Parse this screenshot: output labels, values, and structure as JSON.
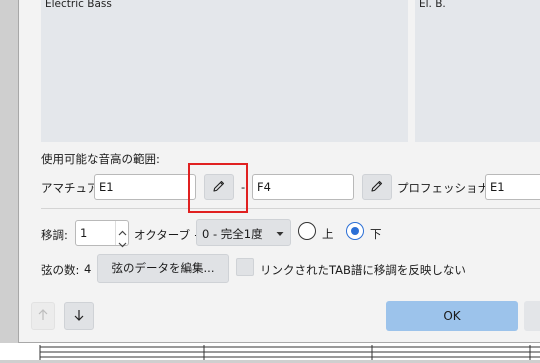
{
  "previews": {
    "left_name": "Electric Bass",
    "right_name": "El. B."
  },
  "range": {
    "heading": "使用可能な音高の範囲:",
    "amateur_label": "アマチュア:",
    "amateur_low": "E1",
    "dash": "-",
    "amateur_high": "F4",
    "professional_label": "プロフェッショナル:",
    "professional_low": "E1"
  },
  "transpose": {
    "label": "移調:",
    "octave_value": "1",
    "octave_label": "オクターブ +",
    "interval_value": "0 - 完全1度",
    "up_label": "上",
    "down_label": "下",
    "selected": "down"
  },
  "strings": {
    "count_label": "弦の数:",
    "count_value": "4",
    "edit_button": "弦のデータを編集...",
    "linked_tab_label": "リンクされたTAB譜に移調を反映しない",
    "linked_tab_checked": false
  },
  "footer": {
    "ok_label": "OK"
  },
  "icons": {
    "pencil": "pencil-icon",
    "arrow_up": "arrow-up-icon",
    "arrow_down": "arrow-down-icon",
    "spin_up": "chevron-up-icon",
    "spin_down": "chevron-down-icon",
    "dropdown": "caret-down-icon"
  },
  "colors": {
    "accent": "#2b6fd6",
    "ok_button": "#9cc3eb",
    "highlight": "#e02020"
  }
}
